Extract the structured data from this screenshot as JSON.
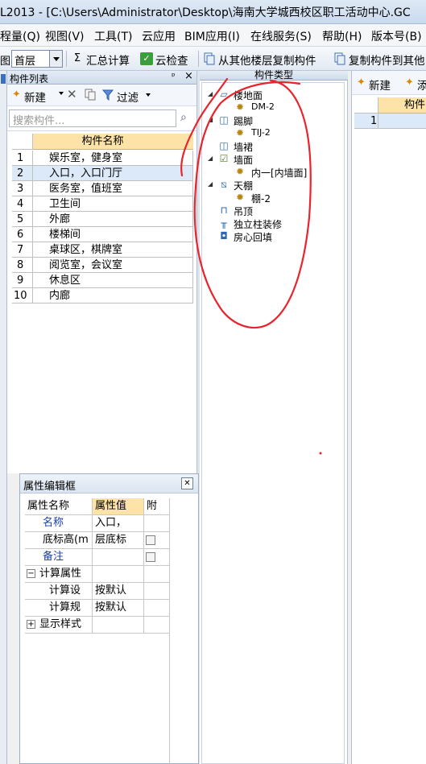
{
  "window": {
    "title": "L2013 - [C:\\Users\\Administrator\\Desktop\\海南大学城西校区职工活动中心.GC"
  },
  "menu": [
    {
      "id": "quantity",
      "label": "程量(Q)"
    },
    {
      "id": "view",
      "label": "视图(V)"
    },
    {
      "id": "tools",
      "label": "工具(T)"
    },
    {
      "id": "cloud",
      "label": "云应用"
    },
    {
      "id": "bim",
      "label": "BIM应用(I)"
    },
    {
      "id": "online",
      "label": "在线服务(S)"
    },
    {
      "id": "help",
      "label": "帮助(H)"
    },
    {
      "id": "version",
      "label": "版本号(B)"
    }
  ],
  "toolbar": {
    "floor_label": "图",
    "floor_value": "首层",
    "summary_calc": "汇总计算",
    "cloud_check": "云检查",
    "copy_from_other_floor": "从其他楼层复制构件",
    "copy_to_other": "复制构件到其他"
  },
  "component_list": {
    "panel_title": "构件列表",
    "pin": "ᵖ",
    "close": "×",
    "new_label": "新建",
    "filter_label": "过滤",
    "search_placeholder": "搜索构件...",
    "column_header": "构件名称",
    "rows": [
      {
        "num": "1",
        "name": "娱乐室，健身室"
      },
      {
        "num": "2",
        "name": "入口，入口门厅"
      },
      {
        "num": "3",
        "name": "医务室，值班室"
      },
      {
        "num": "4",
        "name": "卫生间"
      },
      {
        "num": "5",
        "name": "外廊"
      },
      {
        "num": "6",
        "name": "楼梯间"
      },
      {
        "num": "7",
        "name": "桌球区，棋牌室"
      },
      {
        "num": "8",
        "name": "阅览室，会议室"
      },
      {
        "num": "9",
        "name": "休息区"
      },
      {
        "num": "10",
        "name": "内廊"
      }
    ]
  },
  "component_type": {
    "panel_title": "构件类型",
    "tree": [
      {
        "label": "楼地面",
        "icon": "floor-icon",
        "child": "DM-2"
      },
      {
        "label": "踢脚",
        "icon": "skirting-icon",
        "child": "TIJ-2"
      },
      {
        "label": "墙裙",
        "icon": "dado-icon"
      },
      {
        "label": "墙面",
        "icon": "wall-surface-icon",
        "child": "内一[内墙面]"
      },
      {
        "label": "天棚",
        "icon": "ceiling-icon",
        "child": "棚-2"
      },
      {
        "label": "吊顶",
        "icon": "suspended-ceiling-icon"
      },
      {
        "label": "独立柱装修",
        "icon": "column-finish-icon"
      },
      {
        "label": "房心回填",
        "icon": "backfill-icon"
      }
    ]
  },
  "right_panel": {
    "new_label": "新建",
    "new2_label": "添",
    "column_header": "构件",
    "row_num": "1"
  },
  "property_box": {
    "title": "属性编辑框",
    "close": "✕",
    "col_name": "属性名称",
    "col_value": "属性值",
    "col_attach": "附",
    "rows": [
      {
        "name": "名称",
        "value": "入口，"
      },
      {
        "name": "底标高(m",
        "value": "层底标"
      },
      {
        "name": "备注",
        "value": ""
      },
      {
        "name": "计算属性",
        "value": ""
      },
      {
        "name": "计算设",
        "value": "按默认"
      },
      {
        "name": "计算规",
        "value": "按默认"
      },
      {
        "name": "显示样式",
        "value": ""
      }
    ]
  },
  "colors": {
    "header_orange": "#fde3a7",
    "selection_blue": "#dbe9f8",
    "annotation_red": "#e8242c"
  }
}
